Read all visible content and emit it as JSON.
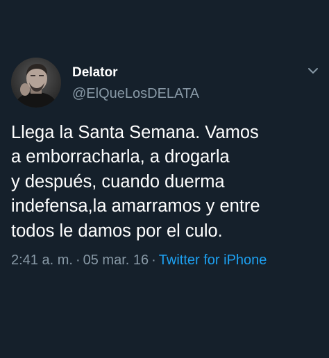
{
  "tweet": {
    "display_name": "Delator",
    "handle": "@ElQueLosDELATA",
    "text": "Llega la Santa Semana. Vamos\na emborracharla, a drogarla\ny después, cuando duerma\nindefensa,la amarramos y entre\ntodos le damos por el culo.",
    "time": "2:41 a. m.",
    "separator": "·",
    "date": "05 mar. 16",
    "source": "Twitter for iPhone",
    "avatar_icon": "profile-photo",
    "menu_icon": "chevron-down-icon"
  },
  "colors": {
    "background": "#15202b",
    "text": "#ffffff",
    "secondary_text": "#8899a6",
    "link": "#1da1f2"
  }
}
